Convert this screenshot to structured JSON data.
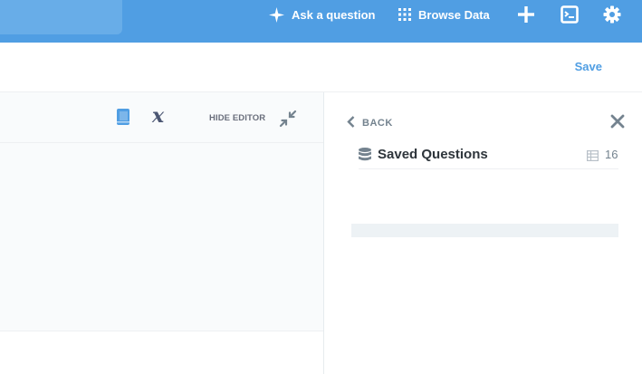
{
  "topnav": {
    "ask_label": "Ask a question",
    "browse_label": "Browse Data",
    "icons": [
      "sparkle-icon",
      "grid-icon",
      "plus-icon",
      "terminal-icon",
      "gear-icon"
    ],
    "background_color": "#509ee3"
  },
  "header": {
    "save_label": "Save",
    "accent_color": "#509ee3"
  },
  "editor": {
    "hide_editor_label": "HIDE EDITOR",
    "variable_glyph": "x",
    "icons": [
      "book-icon",
      "variable-icon",
      "contract-icon"
    ]
  },
  "sidebar": {
    "back_label": "BACK",
    "database": {
      "name": "Saved Questions",
      "table_count": "16"
    },
    "icons": [
      "chevron-left-icon",
      "close-icon",
      "database-icon",
      "table-icon"
    ]
  }
}
